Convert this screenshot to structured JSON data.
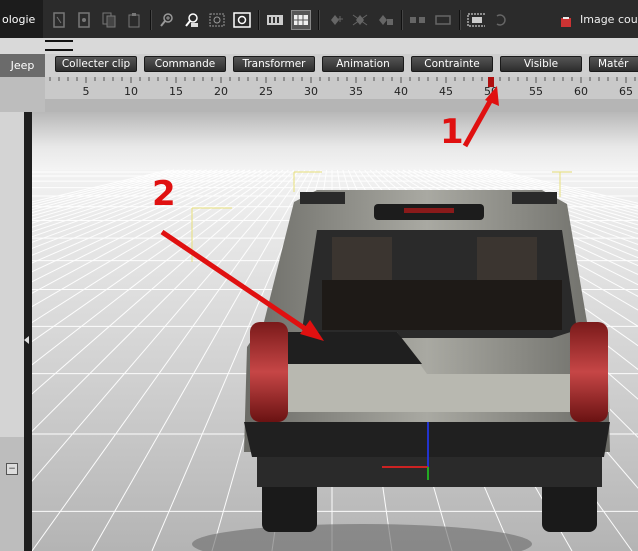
{
  "toolbar": {
    "tab_topology": "ologie",
    "image_label": "Image cou",
    "icons": [
      "bone-icon",
      "bone-chain-icon",
      "copy-bone-icon",
      "paste-bone-icon",
      "zoom-in-icon",
      "zoom-person-icon",
      "zoom-frame-icon",
      "zoom-fit-icon",
      "film-strip-icon",
      "grid-view-icon",
      "add-key-icon",
      "delete-key-icon",
      "lock-key-icon",
      "toggle-icon",
      "loop-icon",
      "camera-frame-icon",
      "refresh-icon"
    ]
  },
  "tracks": {
    "name": "Jeep",
    "buttons": [
      "Collecter clip",
      "Commande",
      "Transformer",
      "Animation",
      "Contrainte",
      "Visible",
      "Matér"
    ]
  },
  "ruler": {
    "ticks": [
      "5",
      "10",
      "15",
      "20",
      "25",
      "30",
      "35",
      "40",
      "45",
      "50",
      "55",
      "60",
      "65"
    ],
    "current_frame": 50
  },
  "annotations": {
    "one": "1",
    "two": "2"
  },
  "colors": {
    "annotation": "#e01010",
    "playhead": "#b01010"
  }
}
